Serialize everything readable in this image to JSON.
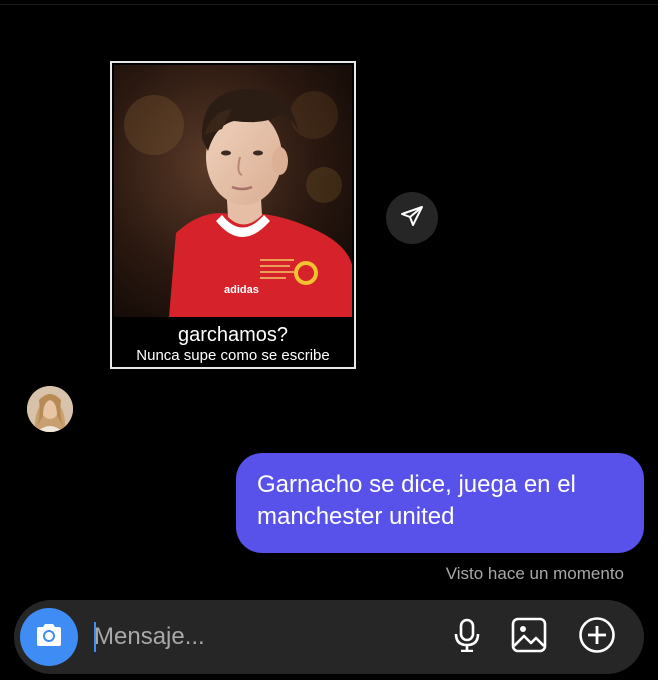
{
  "post": {
    "caption_title": "garchamos?",
    "caption_subtitle": "Nunca supe como se escribe",
    "jersey_sponsor": "adidas"
  },
  "message": {
    "text": "Garnacho se dice, juega en el manchester united",
    "status": "Visto hace un momento"
  },
  "composer": {
    "placeholder": "Mensaje..."
  },
  "colors": {
    "outgoing_bubble": "#5851ea",
    "camera_button": "#3f8cf5",
    "composer_bg": "#262626"
  },
  "icons": [
    "share-send-icon",
    "camera-icon",
    "microphone-icon",
    "gallery-icon",
    "plus-circle-icon"
  ]
}
